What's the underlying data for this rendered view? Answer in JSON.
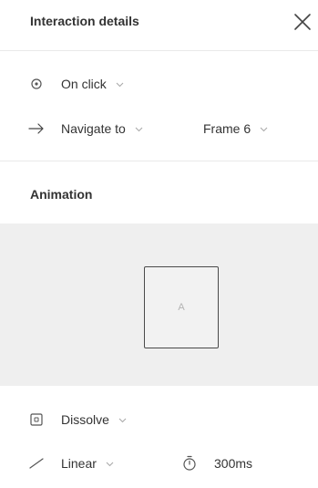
{
  "header": {
    "title": "Interaction details"
  },
  "trigger": {
    "label": "On click",
    "icon": "circle-dot-icon"
  },
  "action": {
    "label": "Navigate to",
    "destination": "Frame 6",
    "icon": "arrow-right-icon"
  },
  "animation": {
    "section_title": "Animation",
    "preview_letter": "A",
    "type": "Dissolve",
    "easing": "Linear",
    "duration": "300ms"
  }
}
